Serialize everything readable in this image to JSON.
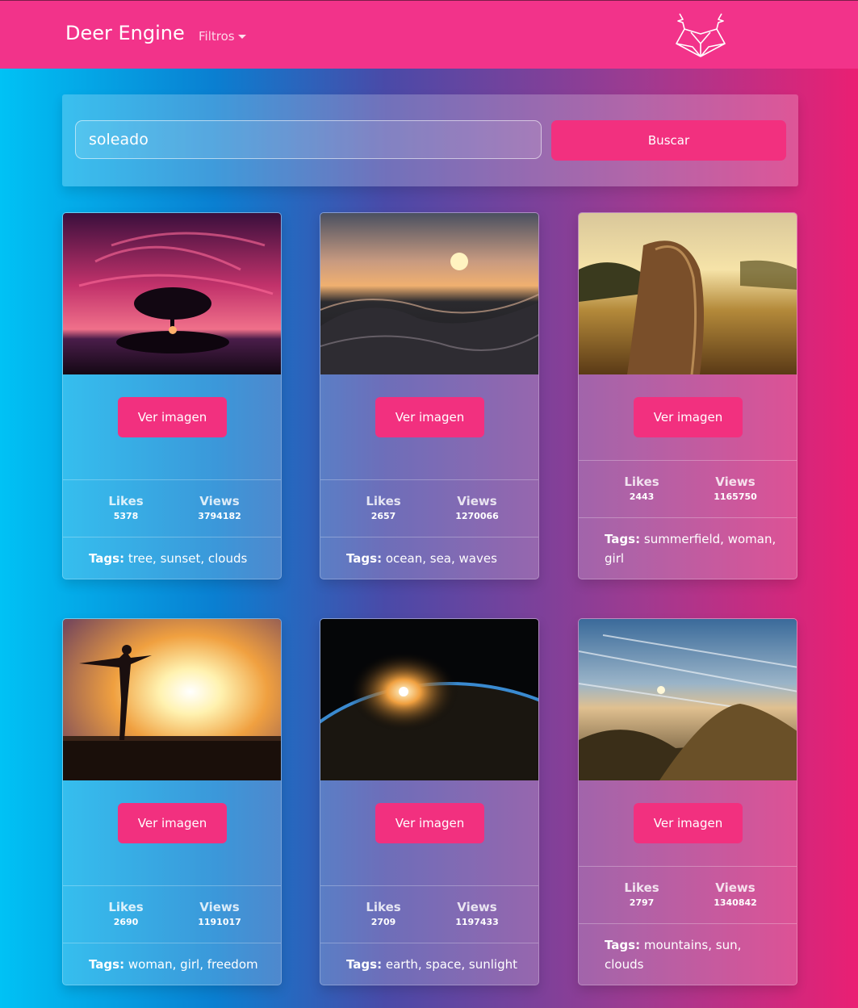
{
  "navbar": {
    "brand": "Deer Engine",
    "filters_label": "Filtros",
    "logo_icon": "deer-head-icon",
    "color": "#f2338a"
  },
  "search": {
    "value": "soleado",
    "button_label": "Buscar"
  },
  "cards": [
    {
      "button_label": "Ver imagen",
      "likes_label": "Likes",
      "likes": "5378",
      "views_label": "Views",
      "views": "3794182",
      "tags_label": "Tags:",
      "tags": "tree, sunset, clouds",
      "image": "tree-sunset-photo"
    },
    {
      "button_label": "Ver imagen",
      "likes_label": "Likes",
      "likes": "2657",
      "views_label": "Views",
      "views": "1270066",
      "tags_label": "Tags:",
      "tags": "ocean, sea, waves",
      "image": "ocean-waves-sunset-photo"
    },
    {
      "button_label": "Ver imagen",
      "likes_label": "Likes",
      "likes": "2443",
      "views_label": "Views",
      "views": "1165750",
      "tags_label": "Tags:",
      "tags": "summerfield, woman, girl",
      "image": "woman-in-field-photo"
    },
    {
      "button_label": "Ver imagen",
      "likes_label": "Likes",
      "likes": "2690",
      "views_label": "Views",
      "views": "1191017",
      "tags_label": "Tags:",
      "tags": "woman, girl, freedom",
      "image": "woman-silhouette-sunset-photo"
    },
    {
      "button_label": "Ver imagen",
      "likes_label": "Likes",
      "likes": "2709",
      "views_label": "Views",
      "views": "1197433",
      "tags_label": "Tags:",
      "tags": "earth, space, sunlight",
      "image": "earth-from-space-photo"
    },
    {
      "button_label": "Ver imagen",
      "likes_label": "Likes",
      "likes": "2797",
      "views_label": "Views",
      "views": "1340842",
      "tags_label": "Tags:",
      "tags": "mountains, sun, clouds",
      "image": "mountain-sky-photo"
    }
  ]
}
